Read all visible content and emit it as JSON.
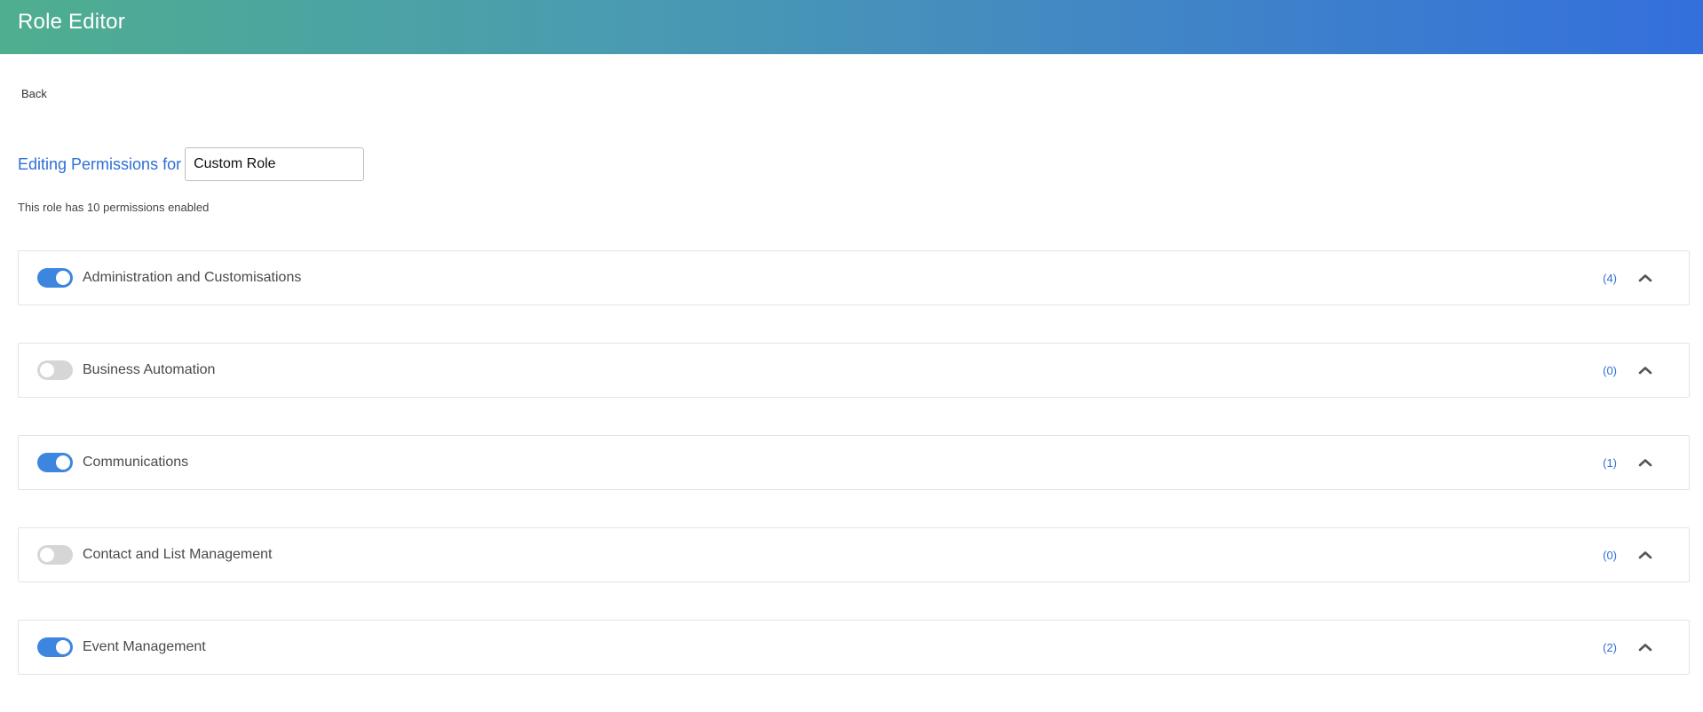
{
  "header": {
    "title": "Role Editor"
  },
  "nav": {
    "back_label": "Back"
  },
  "editor": {
    "editing_label": "Editing Permissions for",
    "role_name": "Custom Role",
    "summary": "This role has 10 permissions enabled"
  },
  "permissions": [
    {
      "name": "Administration and Customisations",
      "count": "(4)",
      "enabled": true
    },
    {
      "name": "Business Automation",
      "count": "(0)",
      "enabled": false
    },
    {
      "name": "Communications",
      "count": "(1)",
      "enabled": true
    },
    {
      "name": "Contact and List Management",
      "count": "(0)",
      "enabled": false
    },
    {
      "name": "Event Management",
      "count": "(2)",
      "enabled": true
    }
  ],
  "colors": {
    "accent": "#3d86e0",
    "toggle_off": "#d6d6d6",
    "header_gradient_start": "#4fae8f",
    "header_gradient_end": "#346fdc"
  },
  "icons": {
    "expand": "chevron-up-icon"
  }
}
